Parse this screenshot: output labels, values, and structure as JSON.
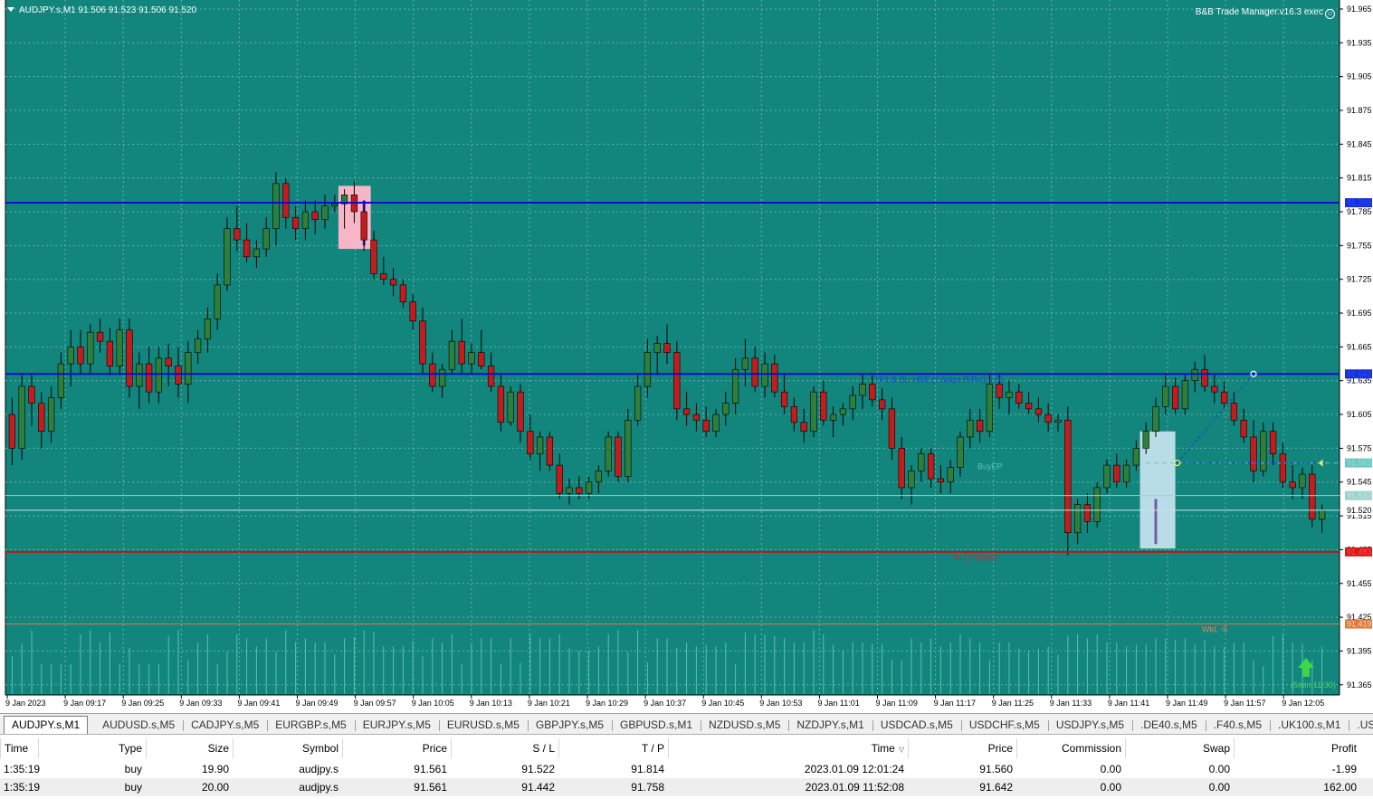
{
  "chart": {
    "symbol_header": "AUDJPY.s,M1  91.506 91.523 91.506 91.520",
    "ea_label": "B&B Trade Manager.v16.3 exec",
    "colors": {
      "background": "#12857d",
      "grid": "#5fb3ab",
      "bull": "#2f7f3c",
      "bear": "#c41c1c",
      "tp_line": "#0b0bd6",
      "sl_line": "#cc1010",
      "wkl_line": "#e07a40",
      "volume": "#5cc0b6"
    },
    "price_axis_labels": [
      "91.965",
      "91.935",
      "91.905",
      "91.875",
      "91.845",
      "91.815",
      "91.785",
      "91.755",
      "91.725",
      "91.695",
      "91.665",
      "91.635",
      "91.605",
      "91.575",
      "91.545",
      "91.515",
      "91.485",
      "91.455",
      "91.425",
      "91.395",
      "91.365"
    ],
    "time_axis_labels": [
      "9 Jan 2023",
      "9 Jan 09:17",
      "9 Jan 09:25",
      "9 Jan 09:33",
      "9 Jan 09:41",
      "9 Jan 09:49",
      "9 Jan 09:57",
      "9 Jan 10:05",
      "9 Jan 10:13",
      "9 Jan 10:21",
      "9 Jan 10:29",
      "9 Jan 10:37",
      "9 Jan 10:45",
      "9 Jan 10:53",
      "9 Jan 11:01",
      "9 Jan 11:09",
      "9 Jan 11:17",
      "9 Jan 11:25",
      "9 Jan 11:33",
      "9 Jan 11:41",
      "9 Jan 11:49",
      "9 Jan 11:57",
      "9 Jan 12:05"
    ],
    "price_min": 91.356,
    "price_max": 91.973,
    "levels": {
      "tp_upper": {
        "price": 91.793,
        "label": "91.793"
      },
      "tp_lower": {
        "price": 91.641,
        "label": "91.641",
        "text": "TP1 & SL->B/E (7.5pips R/R=1:1.9)"
      },
      "entry": {
        "price": 91.562,
        "label": "91.562",
        "text": "BuyEP"
      },
      "bid": {
        "price": 91.533,
        "label": "91.533"
      },
      "current": {
        "price": 91.52,
        "label": "91.520"
      },
      "sl": {
        "price": 91.483,
        "label": "91.483",
        "text": "SL (7.5pips)"
      },
      "wkl": {
        "price": 91.419,
        "label": "91.419",
        "text": "WkL -5"
      }
    },
    "arrow_text": "(5min 11:30)",
    "candles": [
      [
        91.605,
        91.62,
        91.56,
        91.575
      ],
      [
        91.575,
        91.64,
        91.565,
        91.63
      ],
      [
        91.63,
        91.64,
        91.595,
        91.615
      ],
      [
        91.615,
        91.625,
        91.575,
        91.59
      ],
      [
        91.59,
        91.63,
        91.58,
        91.62
      ],
      [
        91.62,
        91.66,
        91.61,
        91.65
      ],
      [
        91.65,
        91.68,
        91.63,
        91.665
      ],
      [
        91.665,
        91.68,
        91.64,
        91.65
      ],
      [
        91.65,
        91.685,
        91.64,
        91.678
      ],
      [
        91.678,
        91.69,
        91.66,
        91.67
      ],
      [
        91.67,
        91.682,
        91.64,
        91.648
      ],
      [
        91.648,
        91.69,
        91.64,
        91.68
      ],
      [
        91.68,
        91.69,
        91.62,
        91.63
      ],
      [
        91.63,
        91.66,
        91.61,
        91.65
      ],
      [
        91.65,
        91.665,
        91.615,
        91.625
      ],
      [
        91.625,
        91.665,
        91.615,
        91.655
      ],
      [
        91.655,
        91.668,
        91.63,
        91.648
      ],
      [
        91.648,
        91.665,
        91.62,
        91.632
      ],
      [
        91.632,
        91.67,
        91.615,
        91.66
      ],
      [
        91.66,
        91.68,
        91.65,
        91.672
      ],
      [
        91.672,
        91.7,
        91.66,
        91.69
      ],
      [
        91.69,
        91.73,
        91.68,
        91.72
      ],
      [
        91.72,
        91.78,
        91.715,
        91.77
      ],
      [
        91.77,
        91.79,
        91.75,
        91.76
      ],
      [
        91.76,
        91.775,
        91.74,
        91.745
      ],
      [
        91.745,
        91.76,
        91.735,
        91.752
      ],
      [
        91.752,
        91.78,
        91.745,
        91.77
      ],
      [
        91.77,
        91.82,
        91.755,
        91.81
      ],
      [
        91.81,
        91.815,
        91.77,
        91.78
      ],
      [
        91.78,
        91.79,
        91.76,
        91.77
      ],
      [
        91.77,
        91.795,
        91.76,
        91.785
      ],
      [
        91.785,
        91.795,
        91.765,
        91.778
      ],
      [
        91.778,
        91.8,
        91.77,
        91.79
      ],
      [
        91.79,
        91.8,
        91.785,
        91.792
      ],
      [
        91.792,
        91.805,
        91.77,
        91.8
      ],
      [
        91.8,
        91.812,
        91.775,
        91.785
      ],
      [
        91.785,
        91.795,
        91.75,
        91.76
      ],
      [
        91.76,
        91.768,
        91.725,
        91.73
      ],
      [
        91.73,
        91.745,
        91.72,
        91.725
      ],
      [
        91.725,
        91.735,
        91.71,
        91.72
      ],
      [
        91.72,
        91.725,
        91.7,
        91.705
      ],
      [
        91.705,
        91.712,
        91.68,
        91.688
      ],
      [
        91.688,
        91.7,
        91.64,
        91.65
      ],
      [
        91.65,
        91.66,
        91.625,
        91.63
      ],
      [
        91.63,
        91.65,
        91.62,
        91.645
      ],
      [
        91.645,
        91.68,
        91.64,
        91.67
      ],
      [
        91.67,
        91.69,
        91.64,
        91.65
      ],
      [
        91.65,
        91.668,
        91.64,
        91.66
      ],
      [
        91.66,
        91.68,
        91.645,
        91.648
      ],
      [
        91.648,
        91.66,
        91.625,
        91.63
      ],
      [
        91.63,
        91.64,
        91.59,
        91.598
      ],
      [
        91.598,
        91.63,
        91.595,
        91.625
      ],
      [
        91.625,
        91.632,
        91.58,
        91.59
      ],
      [
        91.59,
        91.605,
        91.565,
        91.57
      ],
      [
        91.57,
        91.59,
        91.555,
        91.585
      ],
      [
        91.585,
        91.59,
        91.555,
        91.56
      ],
      [
        91.56,
        91.57,
        91.53,
        91.535
      ],
      [
        91.535,
        91.548,
        91.525,
        91.54
      ],
      [
        91.54,
        91.55,
        91.53,
        91.535
      ],
      [
        91.535,
        91.55,
        91.53,
        91.545
      ],
      [
        91.545,
        91.56,
        91.535,
        91.555
      ],
      [
        91.555,
        91.59,
        91.55,
        91.585
      ],
      [
        91.585,
        91.59,
        91.545,
        91.55
      ],
      [
        91.55,
        91.61,
        91.545,
        91.6
      ],
      [
        91.6,
        91.64,
        91.595,
        91.63
      ],
      [
        91.63,
        91.672,
        91.62,
        91.66
      ],
      [
        91.66,
        91.675,
        91.64,
        91.668
      ],
      [
        91.668,
        91.685,
        91.65,
        91.66
      ],
      [
        91.66,
        91.67,
        91.6,
        91.61
      ],
      [
        91.61,
        91.625,
        91.595,
        91.605
      ],
      [
        91.605,
        91.615,
        91.59,
        91.6
      ],
      [
        91.6,
        91.612,
        91.585,
        91.59
      ],
      [
        91.59,
        91.61,
        91.585,
        91.605
      ],
      [
        91.605,
        91.625,
        91.595,
        91.615
      ],
      [
        91.615,
        91.655,
        91.605,
        91.645
      ],
      [
        91.645,
        91.672,
        91.63,
        91.655
      ],
      [
        91.655,
        91.665,
        91.625,
        91.63
      ],
      [
        91.63,
        91.66,
        91.62,
        91.65
      ],
      [
        91.65,
        91.658,
        91.62,
        91.625
      ],
      [
        91.625,
        91.64,
        91.605,
        91.612
      ],
      [
        91.612,
        91.62,
        91.59,
        91.598
      ],
      [
        91.598,
        91.61,
        91.58,
        91.59
      ],
      [
        91.59,
        91.63,
        91.585,
        91.625
      ],
      [
        91.625,
        91.635,
        91.595,
        91.6
      ],
      [
        91.6,
        91.612,
        91.585,
        91.605
      ],
      [
        91.605,
        91.615,
        91.595,
        91.61
      ],
      [
        91.61,
        91.63,
        91.6,
        91.622
      ],
      [
        91.622,
        91.64,
        91.61,
        91.632
      ],
      [
        91.632,
        91.64,
        91.612,
        91.618
      ],
      [
        91.618,
        91.628,
        91.6,
        91.61
      ],
      [
        91.61,
        91.62,
        91.565,
        91.575
      ],
      [
        91.575,
        91.585,
        91.53,
        91.54
      ],
      [
        91.54,
        91.56,
        91.525,
        91.555
      ],
      [
        91.555,
        91.575,
        91.545,
        91.57
      ],
      [
        91.57,
        91.575,
        91.54,
        91.548
      ],
      [
        91.548,
        91.56,
        91.535,
        91.545
      ],
      [
        91.545,
        91.565,
        91.535,
        91.558
      ],
      [
        91.558,
        91.59,
        91.55,
        91.585
      ],
      [
        91.585,
        91.61,
        91.575,
        91.6
      ],
      [
        91.6,
        91.61,
        91.58,
        91.59
      ],
      [
        91.59,
        91.64,
        91.585,
        91.632
      ],
      [
        91.632,
        91.64,
        91.61,
        91.62
      ],
      [
        91.62,
        91.635,
        91.605,
        91.625
      ],
      [
        91.625,
        91.632,
        91.61,
        91.615
      ],
      [
        91.615,
        91.625,
        91.605,
        91.61
      ],
      [
        91.61,
        91.62,
        91.598,
        91.605
      ],
      [
        91.605,
        91.615,
        91.59,
        91.598
      ],
      [
        91.598,
        91.605,
        91.59,
        91.6
      ],
      [
        91.6,
        91.612,
        91.48,
        91.5
      ],
      [
        91.5,
        91.53,
        91.49,
        91.525
      ],
      [
        91.525,
        91.535,
        91.5,
        91.51
      ],
      [
        91.51,
        91.545,
        91.505,
        91.54
      ],
      [
        91.54,
        91.565,
        91.535,
        91.56
      ],
      [
        91.56,
        91.57,
        91.54,
        91.545
      ],
      [
        91.545,
        91.565,
        91.54,
        91.56
      ],
      [
        91.56,
        91.582,
        91.555,
        91.575
      ],
      [
        91.575,
        91.598,
        91.57,
        91.59
      ],
      [
        91.59,
        91.62,
        91.585,
        91.612
      ],
      [
        91.612,
        91.64,
        91.605,
        91.63
      ],
      [
        91.63,
        91.638,
        91.605,
        91.61
      ],
      [
        91.61,
        91.64,
        91.605,
        91.635
      ],
      [
        91.635,
        91.652,
        91.625,
        91.645
      ],
      [
        91.645,
        91.658,
        91.625,
        91.63
      ],
      [
        91.63,
        91.64,
        91.615,
        91.625
      ],
      [
        91.625,
        91.635,
        91.61,
        91.615
      ],
      [
        91.615,
        91.625,
        91.595,
        91.6
      ],
      [
        91.6,
        91.61,
        91.58,
        91.585
      ],
      [
        91.585,
        91.6,
        91.545,
        91.555
      ],
      [
        91.555,
        91.598,
        91.55,
        91.59
      ],
      [
        91.59,
        91.598,
        91.56,
        91.57
      ],
      [
        91.57,
        91.58,
        91.54,
        91.545
      ],
      [
        91.545,
        91.56,
        91.53,
        91.54
      ],
      [
        91.54,
        91.558,
        91.53,
        91.552
      ],
      [
        91.552,
        91.56,
        91.505,
        91.512
      ],
      [
        91.512,
        91.525,
        91.5,
        91.52
      ]
    ]
  },
  "symbol_tabs": [
    "AUDJPY.s,M1",
    "AUDUSD.s,M5",
    "CADJPY.s,M5",
    "EURGBP.s,M5",
    "EURJPY.s,M5",
    "EURUSD.s,M5",
    "GBPJPY.s,M5",
    "GBPUSD.s,M1",
    "NZDUSD.s,M5",
    "NZDJPY.s,M1",
    "USDCAD.s,M5",
    "USDCHF.s,M5",
    "USDJPY.s,M5",
    ".DE40.s,M5",
    ".F40.s,M5",
    ".UK100.s,M1",
    ".US"
  ],
  "table": {
    "headers": [
      "Time",
      "Type",
      "Size",
      "Symbol",
      "Price",
      "S / L",
      "T / P",
      "Time",
      "Price",
      "Commission",
      "Swap",
      "Profit"
    ],
    "rows": [
      [
        "1:35:19",
        "buy",
        "19.90",
        "audjpy.s",
        "91.561",
        "91.522",
        "91.814",
        "2023.01.09 12:01:24",
        "91.560",
        "0.00",
        "0.00",
        "-1.99"
      ],
      [
        "1:35:19",
        "buy",
        "20.00",
        "audjpy.s",
        "91.561",
        "91.442",
        "91.758",
        "2023.01.09 11:52:08",
        "91.642",
        "0.00",
        "0.00",
        "162.00"
      ]
    ]
  }
}
